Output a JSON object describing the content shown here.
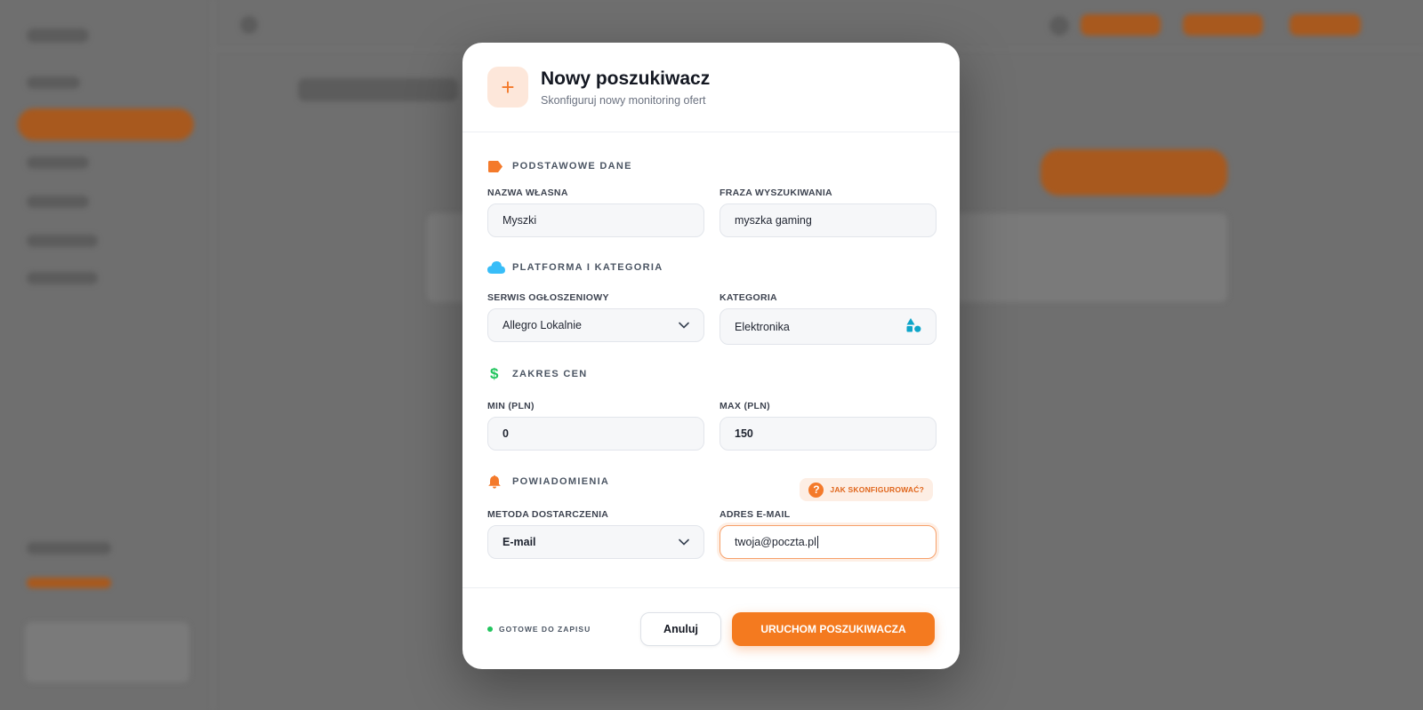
{
  "modal": {
    "title": "Nowy poszukiwacz",
    "subtitle": "Skonfiguruj nowy monitoring ofert",
    "header_icon": "+"
  },
  "sections": {
    "basic": {
      "title": "PODSTAWOWE DANE",
      "icon": "tag-icon",
      "name_label": "NAZWA WŁASNA",
      "name_value": "Myszki",
      "phrase_label": "FRAZA WYSZUKIWANIA",
      "phrase_value": "myszka gaming"
    },
    "platform": {
      "title": "PLATFORMA I KATEGORIA",
      "icon": "cloud-icon",
      "service_label": "SERWIS OGŁOSZENIOWY",
      "service_value": "Allegro Lokalnie",
      "category_label": "KATEGORIA",
      "category_value": "Elektronika"
    },
    "price": {
      "title": "ZAKRES CEN",
      "icon": "dollar-icon",
      "min_label": "MIN (PLN)",
      "min_value": "0",
      "max_label": "MAX (PLN)",
      "max_value": "150"
    },
    "notifications": {
      "title": "POWIADOMIENIA",
      "icon": "bell-icon",
      "help_label": "JAK SKONFIGUROWAĆ?",
      "method_label": "METODA DOSTARCZENIA",
      "method_value": "E-mail",
      "email_label": "ADRES E-MAIL",
      "email_value": "twoja@poczta.pl"
    }
  },
  "footer": {
    "status": "GOTOWE DO ZAPISU",
    "cancel_label": "Anuluj",
    "submit_label": "URUCHOM POSZUKIWACZA"
  },
  "colors": {
    "accent": "#f47a1f",
    "status_ok": "#22c55e",
    "cloud": "#38bdf8",
    "dollar": "#22c55e"
  }
}
